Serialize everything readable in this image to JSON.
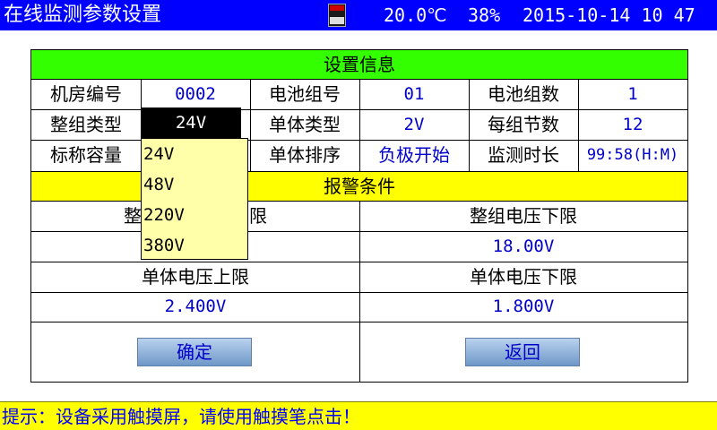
{
  "header": {
    "title": "在线监测参数设置",
    "temperature": "20.0℃",
    "humidity": "38%",
    "datetime": "2015-10-14 10 47"
  },
  "colors": {
    "topbar": "#0000ff",
    "section_info": "#33ff00",
    "section_alarm": "#ffff00",
    "value_text": "#0000cc",
    "tip_text": "#0000ff"
  },
  "info": {
    "section_title": "设置信息",
    "rows": [
      [
        {
          "label": "机房编号",
          "value": "0002"
        },
        {
          "label": "电池组号",
          "value": "01"
        },
        {
          "label": "电池组数",
          "value": "1"
        }
      ],
      [
        {
          "label": "整组类型",
          "value": "24V"
        },
        {
          "label": "单体类型",
          "value": "2V"
        },
        {
          "label": "每组节数",
          "value": "12"
        }
      ],
      [
        {
          "label": "标称容量",
          "value": ""
        },
        {
          "label": "单体排序",
          "value": "负极开始"
        },
        {
          "label": "监测时长",
          "value": "99:58(H:M)"
        }
      ]
    ]
  },
  "dropdown": {
    "options": [
      "24V",
      "48V",
      "220V",
      "380V"
    ]
  },
  "alarm": {
    "section_title": "报警条件",
    "group_upper_label_fragment_left": "整",
    "group_upper_label_fragment_right": "限",
    "group_lower_label": "整组电压下限",
    "group_lower_value": "18.00V",
    "cell_upper_label": "单体电压上限",
    "cell_upper_value": "2.400V",
    "cell_lower_label": "单体电压下限",
    "cell_lower_value": "1.800V"
  },
  "buttons": {
    "confirm": "确定",
    "back": "返回"
  },
  "footer": {
    "tip": "提示：设备采用触摸屏，请使用触摸笔点击！"
  }
}
